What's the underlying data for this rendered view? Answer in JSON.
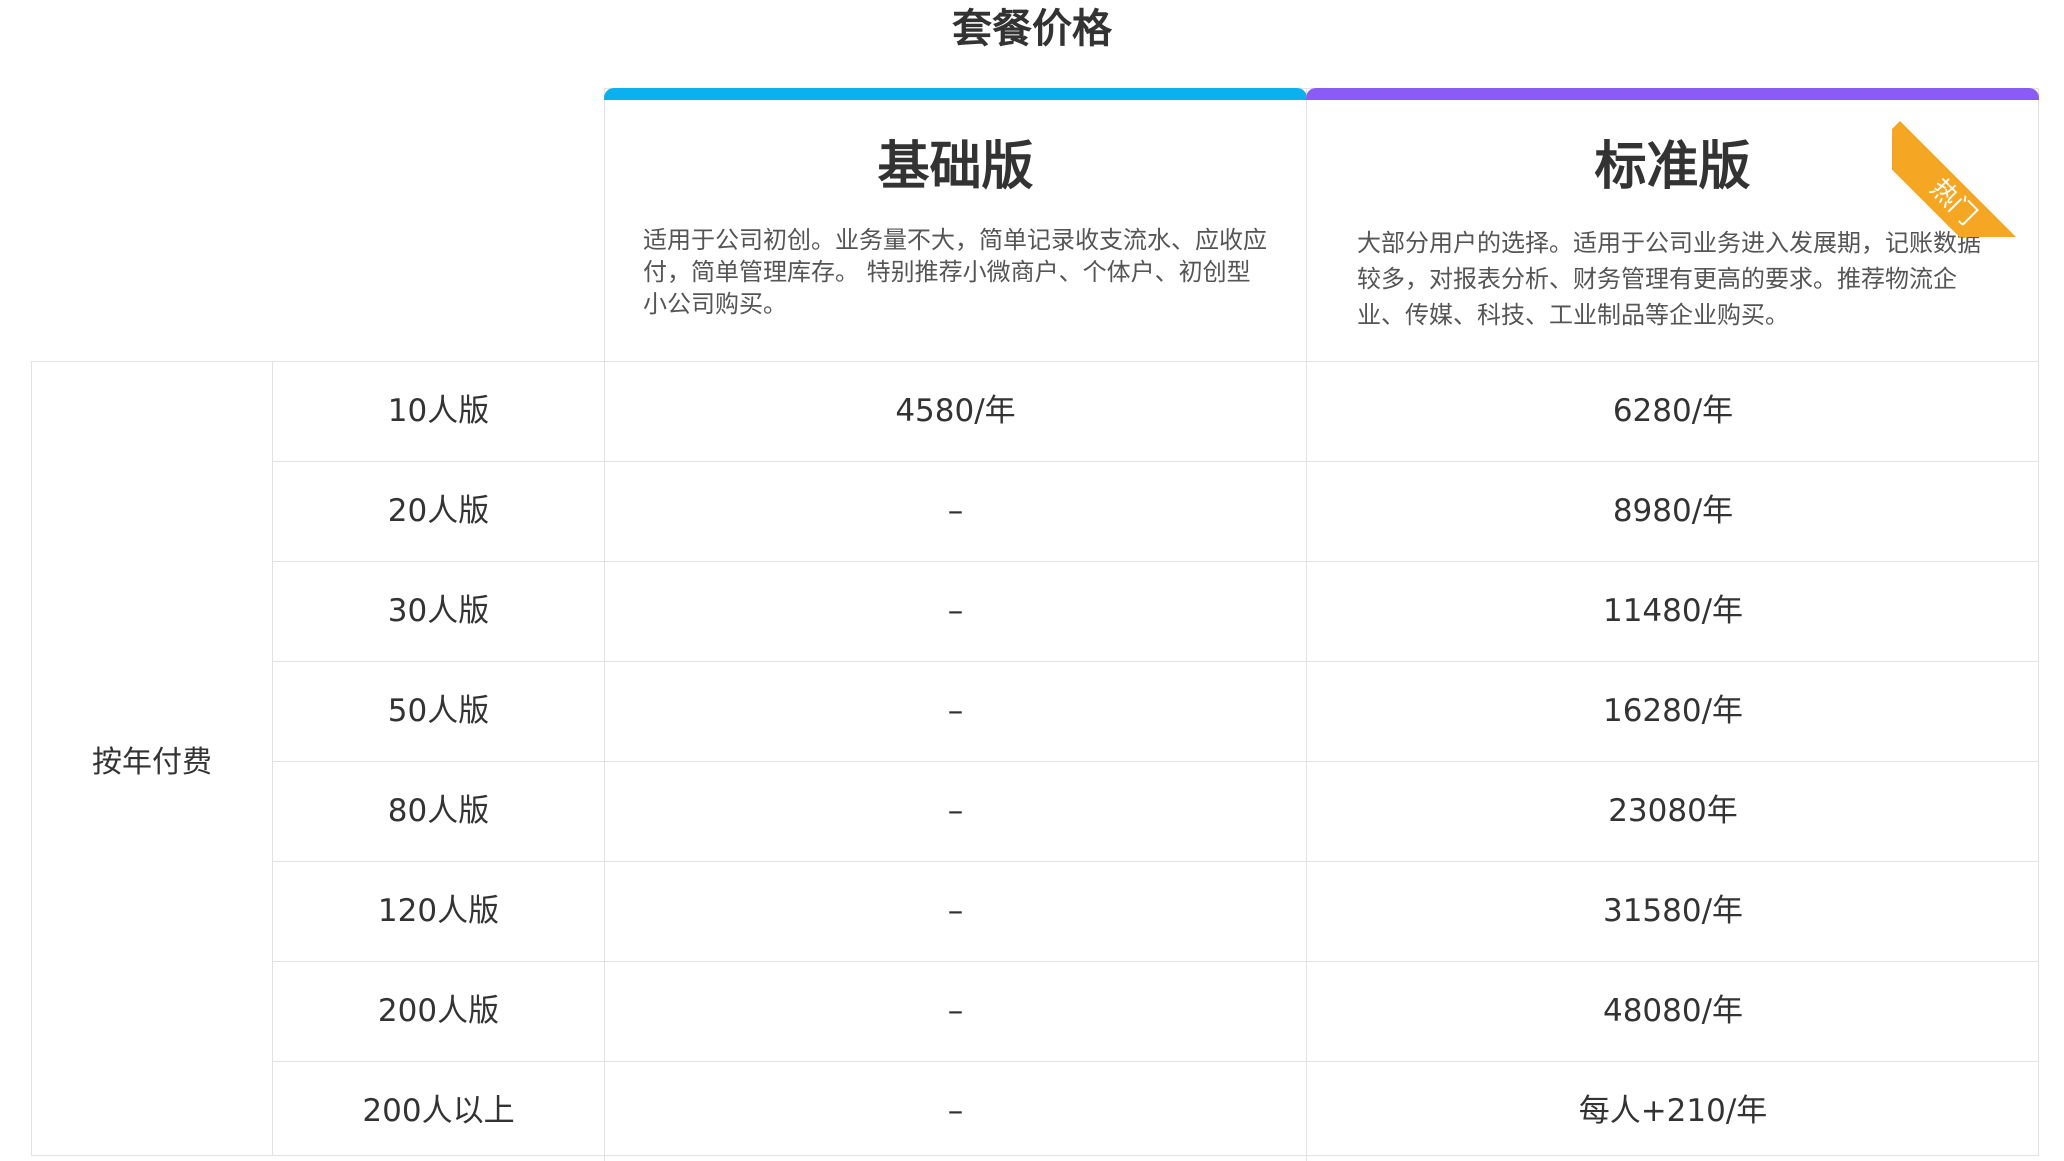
{
  "page_title": "套餐价格",
  "plans": [
    {
      "name": "基础版",
      "description": "适用于公司初创。业务量不大，简单记录收支流水、应收应付，简单管理库存。 特别推荐小微商户、个体户、初创型小公司购买。",
      "accent_color": "#0bb1ee"
    },
    {
      "name": "标准版",
      "description": "大部分用户的选择。适用于公司业务进入发展期，记账数据较多，对报表分析、财务管理有更高的要求。推荐物流企业、传媒、科技、工业制品等企业购买。",
      "accent_color": "#8a5cf5",
      "badge": "热门",
      "badge_color": "#f5a623"
    }
  ],
  "billing_group": "按年付费",
  "rows": [
    {
      "tier": "10人版",
      "basic": "4580/年",
      "standard": "6280/年"
    },
    {
      "tier": "20人版",
      "basic": "–",
      "standard": "8980/年"
    },
    {
      "tier": "30人版",
      "basic": "–",
      "standard": "11480/年"
    },
    {
      "tier": "50人版",
      "basic": "–",
      "standard": "16280/年"
    },
    {
      "tier": "80人版",
      "basic": "–",
      "standard": "23080年"
    },
    {
      "tier": "120人版",
      "basic": "–",
      "standard": "31580/年"
    },
    {
      "tier": "200人版",
      "basic": "–",
      "standard": "48080/年"
    },
    {
      "tier": "200人以上",
      "basic": "–",
      "standard": "每人+210/年"
    }
  ]
}
